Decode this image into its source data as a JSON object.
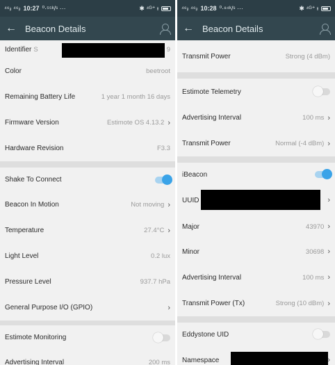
{
  "left": {
    "status": {
      "signal": "⁴⁶ᵢₗ ⁴⁶ᵢₗ",
      "time": "10:27",
      "extra": "⁰·⁵⁵ᵏ/ˢ ···",
      "icons": "✱ ⁴ᴳ⁺ ᵻ"
    },
    "appbar": {
      "back_icon": "←",
      "title": "Beacon Details",
      "account_icon": "person-icon"
    },
    "rows": {
      "identifier": {
        "label": "Identifier",
        "value_start": "S",
        "value_end": "9"
      },
      "color": {
        "label": "Color",
        "value": "beetroot"
      },
      "battery": {
        "label": "Remaining Battery Life",
        "value": "1 year 1 month 16 days"
      },
      "firmware": {
        "label": "Firmware Version",
        "value": "Estimote OS 4.13.2"
      },
      "hardware": {
        "label": "Hardware Revision",
        "value": "F3.3"
      },
      "shake": {
        "label": "Shake To Connect",
        "enabled": true
      },
      "motion": {
        "label": "Beacon In Motion",
        "value": "Not moving"
      },
      "temperature": {
        "label": "Temperature",
        "value": "27.4°C"
      },
      "light": {
        "label": "Light Level",
        "value": "0.2 lux"
      },
      "pressure": {
        "label": "Pressure Level",
        "value": "937.7 hPa"
      },
      "gpio": {
        "label": "General Purpose I/O (GPIO)"
      },
      "monitoring": {
        "label": "Estimote Monitoring",
        "enabled": false
      },
      "adv_interval": {
        "label": "Advertising Interval",
        "value": "200 ms"
      }
    }
  },
  "right": {
    "status": {
      "signal": "⁴⁶ᵢₗ ⁴⁶ᵢₗ",
      "time": "10:28",
      "extra": "⁰·⁸⁴ᵏ/ˢ ···",
      "icons": "✱ ⁴ᴳ⁺ ᵻ"
    },
    "appbar": {
      "back_icon": "←",
      "title": "Beacon Details",
      "account_icon": "person-icon"
    },
    "rows": {
      "tx_power_top": {
        "label": "Transmit Power",
        "value": "Strong (4 dBm)"
      },
      "telemetry": {
        "label": "Estimote Telemetry",
        "enabled": false
      },
      "telemetry_interval": {
        "label": "Advertising Interval",
        "value": "100 ms"
      },
      "telemetry_power": {
        "label": "Transmit Power",
        "value": "Normal (-4 dBm)"
      },
      "ibeacon": {
        "label": "iBeacon",
        "enabled": true
      },
      "uuid": {
        "label": "UUID"
      },
      "major": {
        "label": "Major",
        "value": "43970"
      },
      "minor": {
        "label": "Minor",
        "value": "30698"
      },
      "ibeacon_interval": {
        "label": "Advertising Interval",
        "value": "100 ms"
      },
      "ibeacon_power": {
        "label": "Transmit Power (Tx)",
        "value": "Strong (10 dBm)"
      },
      "eddystone": {
        "label": "Eddystone UID",
        "enabled": false
      },
      "namespace": {
        "label": "Namespace"
      }
    }
  },
  "chevron_icon": "›"
}
